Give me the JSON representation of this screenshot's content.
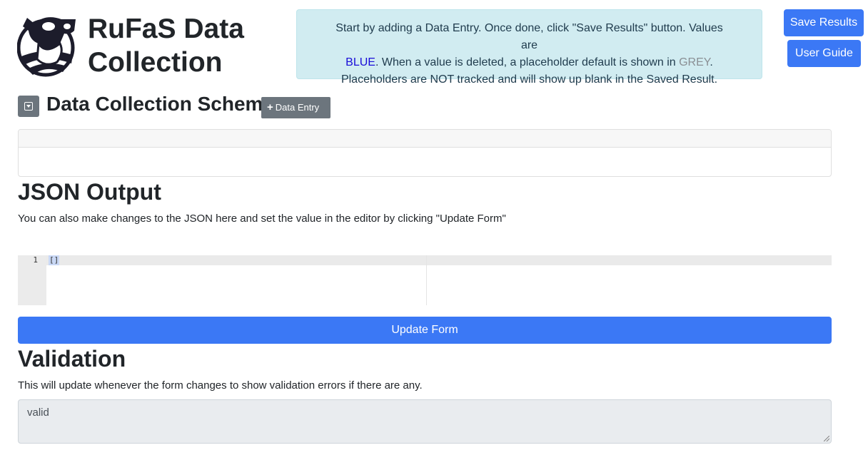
{
  "header": {
    "title_line1": "RuFaS Data",
    "title_line2": "Collection"
  },
  "info": {
    "part1": "Start by adding a Data Entry. Once done, click \"Save Results\" button. Values are",
    "blue_word": "BLUE",
    "part2": ". When a value is deleted, a placeholder default is shown in ",
    "grey_word": "GREY",
    "part3": ".",
    "part4": "Placeholders are NOT tracked and will show up blank in the Saved Result."
  },
  "buttons": {
    "save_results": "Save Results",
    "user_guide": "User Guide",
    "add_entry": "Data Entry",
    "update_form": "Update Form"
  },
  "schema": {
    "title": "Data Collection Schema"
  },
  "json_output": {
    "title": "JSON Output",
    "description": "You can also make changes to the JSON here and set the value in the editor by clicking \"Update Form\"",
    "line_number": "1",
    "code": "[]"
  },
  "validation": {
    "title": "Validation",
    "description": "This will update whenever the form changes to show validation errors if there are any.",
    "value": "valid"
  },
  "colors": {
    "primary": "#3b78f5",
    "secondary": "#6c757d",
    "info_bg": "#d1ecf1"
  }
}
